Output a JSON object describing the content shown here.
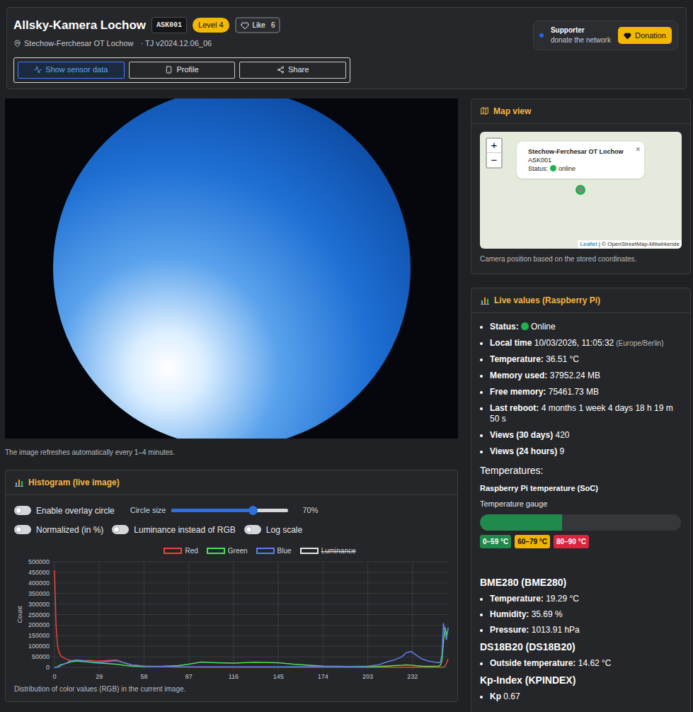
{
  "header": {
    "title": "Allsky-Kamera Lochow",
    "id_badge": "ASK001",
    "level_badge": "Level 4",
    "like": {
      "label": "Like",
      "count": "6",
      "liked": false
    },
    "location": "Stechow-Ferchesar OT Lochow",
    "version": "· TJ v2024.12.06_06",
    "buttons": [
      {
        "label": "Show sensor data",
        "selected": true
      },
      {
        "label": "Profile",
        "selected": false
      },
      {
        "label": "Share",
        "selected": false
      }
    ]
  },
  "supporter": {
    "title": "Supporter",
    "subtitle": "donate the network",
    "button": "Donation"
  },
  "camera": {
    "caption": "The image refreshes automatically every 1–4 minutes."
  },
  "histogram": {
    "title": "Histogram (live image)",
    "control_rows": [
      [
        {
          "kind": "toggle",
          "label": "Enable overlay circle",
          "on": false
        },
        {
          "kind": "slider",
          "label": "Circle size",
          "level": 0.7,
          "reading": "70%"
        }
      ],
      [
        {
          "kind": "toggle",
          "label": "Normalized (in %)",
          "on": false
        },
        {
          "kind": "toggle",
          "label": "Luminance instead of RGB",
          "on": false
        },
        {
          "kind": "toggle",
          "label": "Log scale",
          "on": false
        }
      ]
    ],
    "chart": {
      "y_label": "Count",
      "y_ticks": [
        "0",
        "50000",
        "100000",
        "150000",
        "200000",
        "250000",
        "300000",
        "350000",
        "400000",
        "450000",
        "500000"
      ],
      "x_ticks": [
        "0",
        "29",
        "58",
        "87",
        "116",
        "145",
        "174",
        "203",
        "232"
      ],
      "bins": [
        0,
        1,
        2,
        3,
        4,
        6,
        8,
        10,
        14,
        18,
        22,
        26,
        30,
        35,
        40,
        45,
        50,
        58,
        70,
        80,
        87,
        95,
        105,
        116,
        130,
        145,
        155,
        165,
        174,
        190,
        203,
        210,
        215,
        220,
        225,
        228,
        231,
        234,
        238,
        242,
        246,
        249,
        250,
        251,
        252,
        253,
        254,
        255
      ],
      "series": [
        {
          "name": "Red",
          "color": "#e8453c",
          "visible": true,
          "values": [
            460000,
            200000,
            100000,
            70000,
            55000,
            45000,
            38000,
            33000,
            30000,
            32000,
            33000,
            31000,
            30000,
            33000,
            35000,
            22000,
            12000,
            6000,
            3000,
            2000,
            1500,
            1000,
            1000,
            1000,
            800,
            800,
            700,
            600,
            600,
            500,
            500,
            500,
            500,
            500,
            500,
            500,
            500,
            500,
            500,
            500,
            500,
            600,
            800,
            1000,
            2000,
            5000,
            20000,
            40000
          ]
        },
        {
          "name": "Green",
          "color": "#4ee04e",
          "visible": true,
          "values": [
            0,
            1000,
            3000,
            8000,
            12000,
            16000,
            20000,
            25000,
            30000,
            28000,
            25000,
            22000,
            20000,
            18000,
            15000,
            10000,
            6000,
            3000,
            5000,
            8000,
            15000,
            25000,
            22000,
            20000,
            24000,
            22000,
            15000,
            10000,
            6000,
            4000,
            3000,
            4000,
            6000,
            8000,
            10000,
            12000,
            10000,
            8000,
            6000,
            5000,
            5000,
            6000,
            10000,
            30000,
            120000,
            190000,
            150000,
            180000
          ]
        },
        {
          "name": "Blue",
          "color": "#5b7fe8",
          "visible": true,
          "values": [
            0,
            500,
            1000,
            3000,
            8000,
            15000,
            22000,
            30000,
            35000,
            33000,
            28000,
            25000,
            24000,
            28000,
            32000,
            22000,
            12000,
            6000,
            4000,
            3000,
            2500,
            2500,
            2500,
            2500,
            2500,
            2500,
            3000,
            3000,
            3000,
            4000,
            6000,
            12000,
            25000,
            35000,
            50000,
            70000,
            75000,
            60000,
            40000,
            30000,
            25000,
            22000,
            25000,
            60000,
            210000,
            160000,
            130000,
            190000
          ]
        },
        {
          "name": "Luminance",
          "color": "#e5e5e5",
          "visible": false,
          "values": []
        }
      ]
    },
    "caption": "Distribution of color values (RGB) in the current image."
  },
  "map": {
    "title": "Map view",
    "zoom_in": "+",
    "zoom_out": "−",
    "popup": {
      "title": "Stechow-Ferchesar OT Lochow",
      "id": "ASK001",
      "status_label": "Status:",
      "status": "online",
      "color": "#22b14c",
      "close": "×"
    },
    "attribution": {
      "leaflet": "Leaflet",
      "rest": "| © OpenStreetMap-Mitwirkende"
    },
    "caption": "Camera position based on the stored coordinates."
  },
  "live": {
    "title": "Live values (Raspberry Pi)",
    "items": [
      {
        "kind": "status",
        "label": "Status:",
        "value": "Online",
        "color": "#22b14c"
      },
      {
        "kind": "text",
        "label": "Local time",
        "value": "10/03/2026, 11:05:32",
        "note": "(Europe/Berlin)"
      },
      {
        "kind": "text",
        "label": "Temperature:",
        "value": "36.51 °C"
      },
      {
        "kind": "text",
        "label": "Memory used:",
        "value": "37952.24 MB"
      },
      {
        "kind": "text",
        "label": "Free memory:",
        "value": "75461.73 MB"
      },
      {
        "kind": "text",
        "label": "Last reboot:",
        "value": "4 months 1 week 4 days 18 h 19 m 50 s"
      },
      {
        "kind": "text",
        "label": "Views (30 days)",
        "value": "420"
      },
      {
        "kind": "text",
        "label": "Views (24 hours)",
        "value": "9"
      }
    ],
    "temperatures": {
      "heading": "Temperatures:",
      "sensor": "Raspberry Pi temperature (SoC)",
      "gauge_label": "Temperature gauge",
      "level": 0.41,
      "color": "#1f8a4c",
      "ranges": [
        {
          "label": "0–59 °C",
          "color": "#1f8a4c"
        },
        {
          "label": "60–79 °C",
          "color": "#f0b400"
        },
        {
          "label": "80–90 °C",
          "color": "#d7263d"
        }
      ]
    },
    "sensors": [
      {
        "title": "BME280 (BME280)",
        "items": [
          {
            "label": "Temperature:",
            "value": "19.29 °C"
          },
          {
            "label": "Humidity:",
            "value": "35.69 %"
          },
          {
            "label": "Pressure:",
            "value": "1013.91 hPa"
          }
        ]
      },
      {
        "title": "DS18B20 (DS18B20)",
        "items": [
          {
            "label": "Outside temperature:",
            "value": "14.62 °C"
          }
        ]
      },
      {
        "title": "Kp-Index (KPINDEX)",
        "items": [
          {
            "label": "Kp",
            "value": "0.67"
          }
        ]
      }
    ]
  }
}
